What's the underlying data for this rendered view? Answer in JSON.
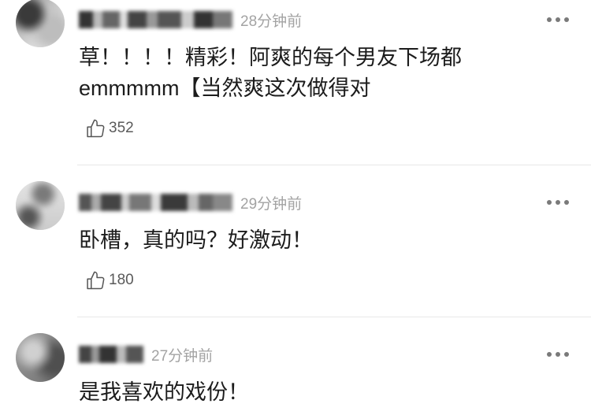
{
  "comments": [
    {
      "time": "28分钟前",
      "text_lines": [
        "草！！！！精彩！阿爽的每个男友下场都",
        "emmmmm【当然爽这次做得对"
      ],
      "likes": "352"
    },
    {
      "time": "29分钟前",
      "text_lines": [
        "卧槽，真的吗？好激动！"
      ],
      "likes": "180"
    },
    {
      "time": "27分钟前",
      "text_lines": [
        "是我喜欢的戏份！"
      ]
    }
  ],
  "icons": {
    "like": "thumbs-up-icon",
    "more": "more-dots-icon",
    "avatar": "avatar-image"
  },
  "colors": {
    "text": "#1c1c1c",
    "meta": "#a3a3a3",
    "divider": "#e8e8e8"
  }
}
